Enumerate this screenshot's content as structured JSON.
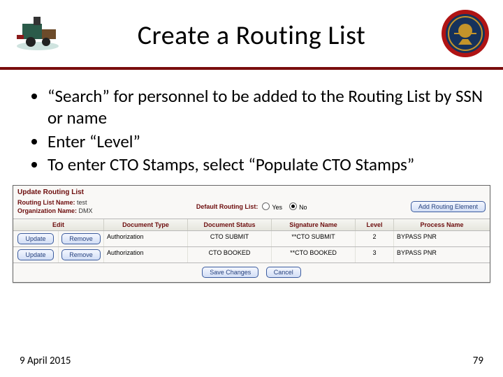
{
  "slide": {
    "title": "Create a Routing List",
    "bullets": [
      "“Search” for personnel to be added to the Routing List by SSN or name",
      "Enter “Level”",
      "To enter CTO Stamps, select “Populate CTO Stamps”"
    ],
    "footer_date": "9 April 2015",
    "page_number": "79"
  },
  "app": {
    "panel_title": "Update Routing List",
    "routing_list_label": "Routing List Name:",
    "routing_list_value": "test",
    "org_label": "Organization Name:",
    "org_value": "DMX",
    "default_routing_label": "Default Routing List:",
    "default_routing_options": [
      "Yes",
      "No"
    ],
    "default_routing_selected": "No",
    "add_element_btn": "Add Routing Element",
    "columns": {
      "edit": "Edit",
      "doc_type": "Document Type",
      "doc_status": "Document Status",
      "sig_name": "Signature Name",
      "level": "Level",
      "process": "Process Name"
    },
    "rows": [
      {
        "update": "Update",
        "remove": "Remove",
        "doc_type": "Authorization",
        "doc_status": "CTO SUBMIT",
        "sig_name": "**CTO SUBMIT",
        "level": "2",
        "process": "BYPASS PNR"
      },
      {
        "update": "Update",
        "remove": "Remove",
        "doc_type": "Authorization",
        "doc_status": "CTO BOOKED",
        "sig_name": "**CTO BOOKED",
        "level": "3",
        "process": "BYPASS PNR"
      }
    ],
    "footer_buttons": [
      "Save Changes",
      "Cancel"
    ]
  }
}
